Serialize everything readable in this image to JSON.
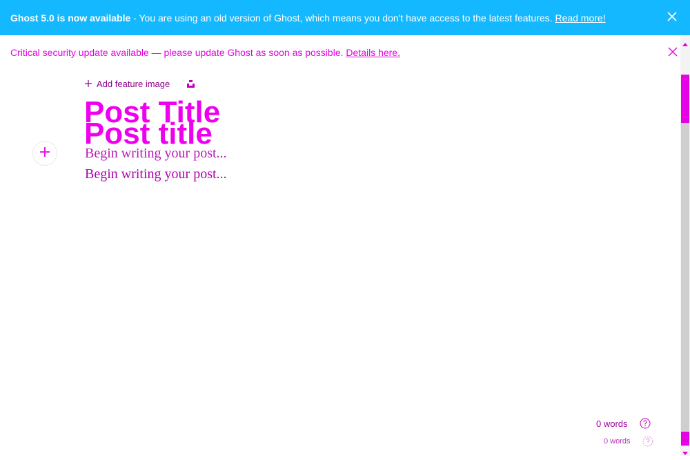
{
  "banner_upgrade": {
    "strong": "Ghost 5.0 is now available",
    "text": " - You are using an old version of Ghost, which means you don't have access to the latest features. ",
    "link": "Read more!",
    "close_icon": "close-icon"
  },
  "banner_security": {
    "text": "Critical security update available — please update Ghost as soon as possible. ",
    "link": "Details here.",
    "close_icon": "close-icon"
  },
  "editor": {
    "feature_image_label": "Add feature image",
    "title_primary": "Post Title",
    "title_placeholder": "Post title",
    "body_placeholder": "Begin writing your post...",
    "body_placeholder_2": "Begin writing your post..."
  },
  "footer": {
    "word_count": "0 words",
    "word_count_2": "0 words"
  },
  "colors": {
    "banner_blue": "#14b8ff",
    "accent": "#e600e6"
  }
}
